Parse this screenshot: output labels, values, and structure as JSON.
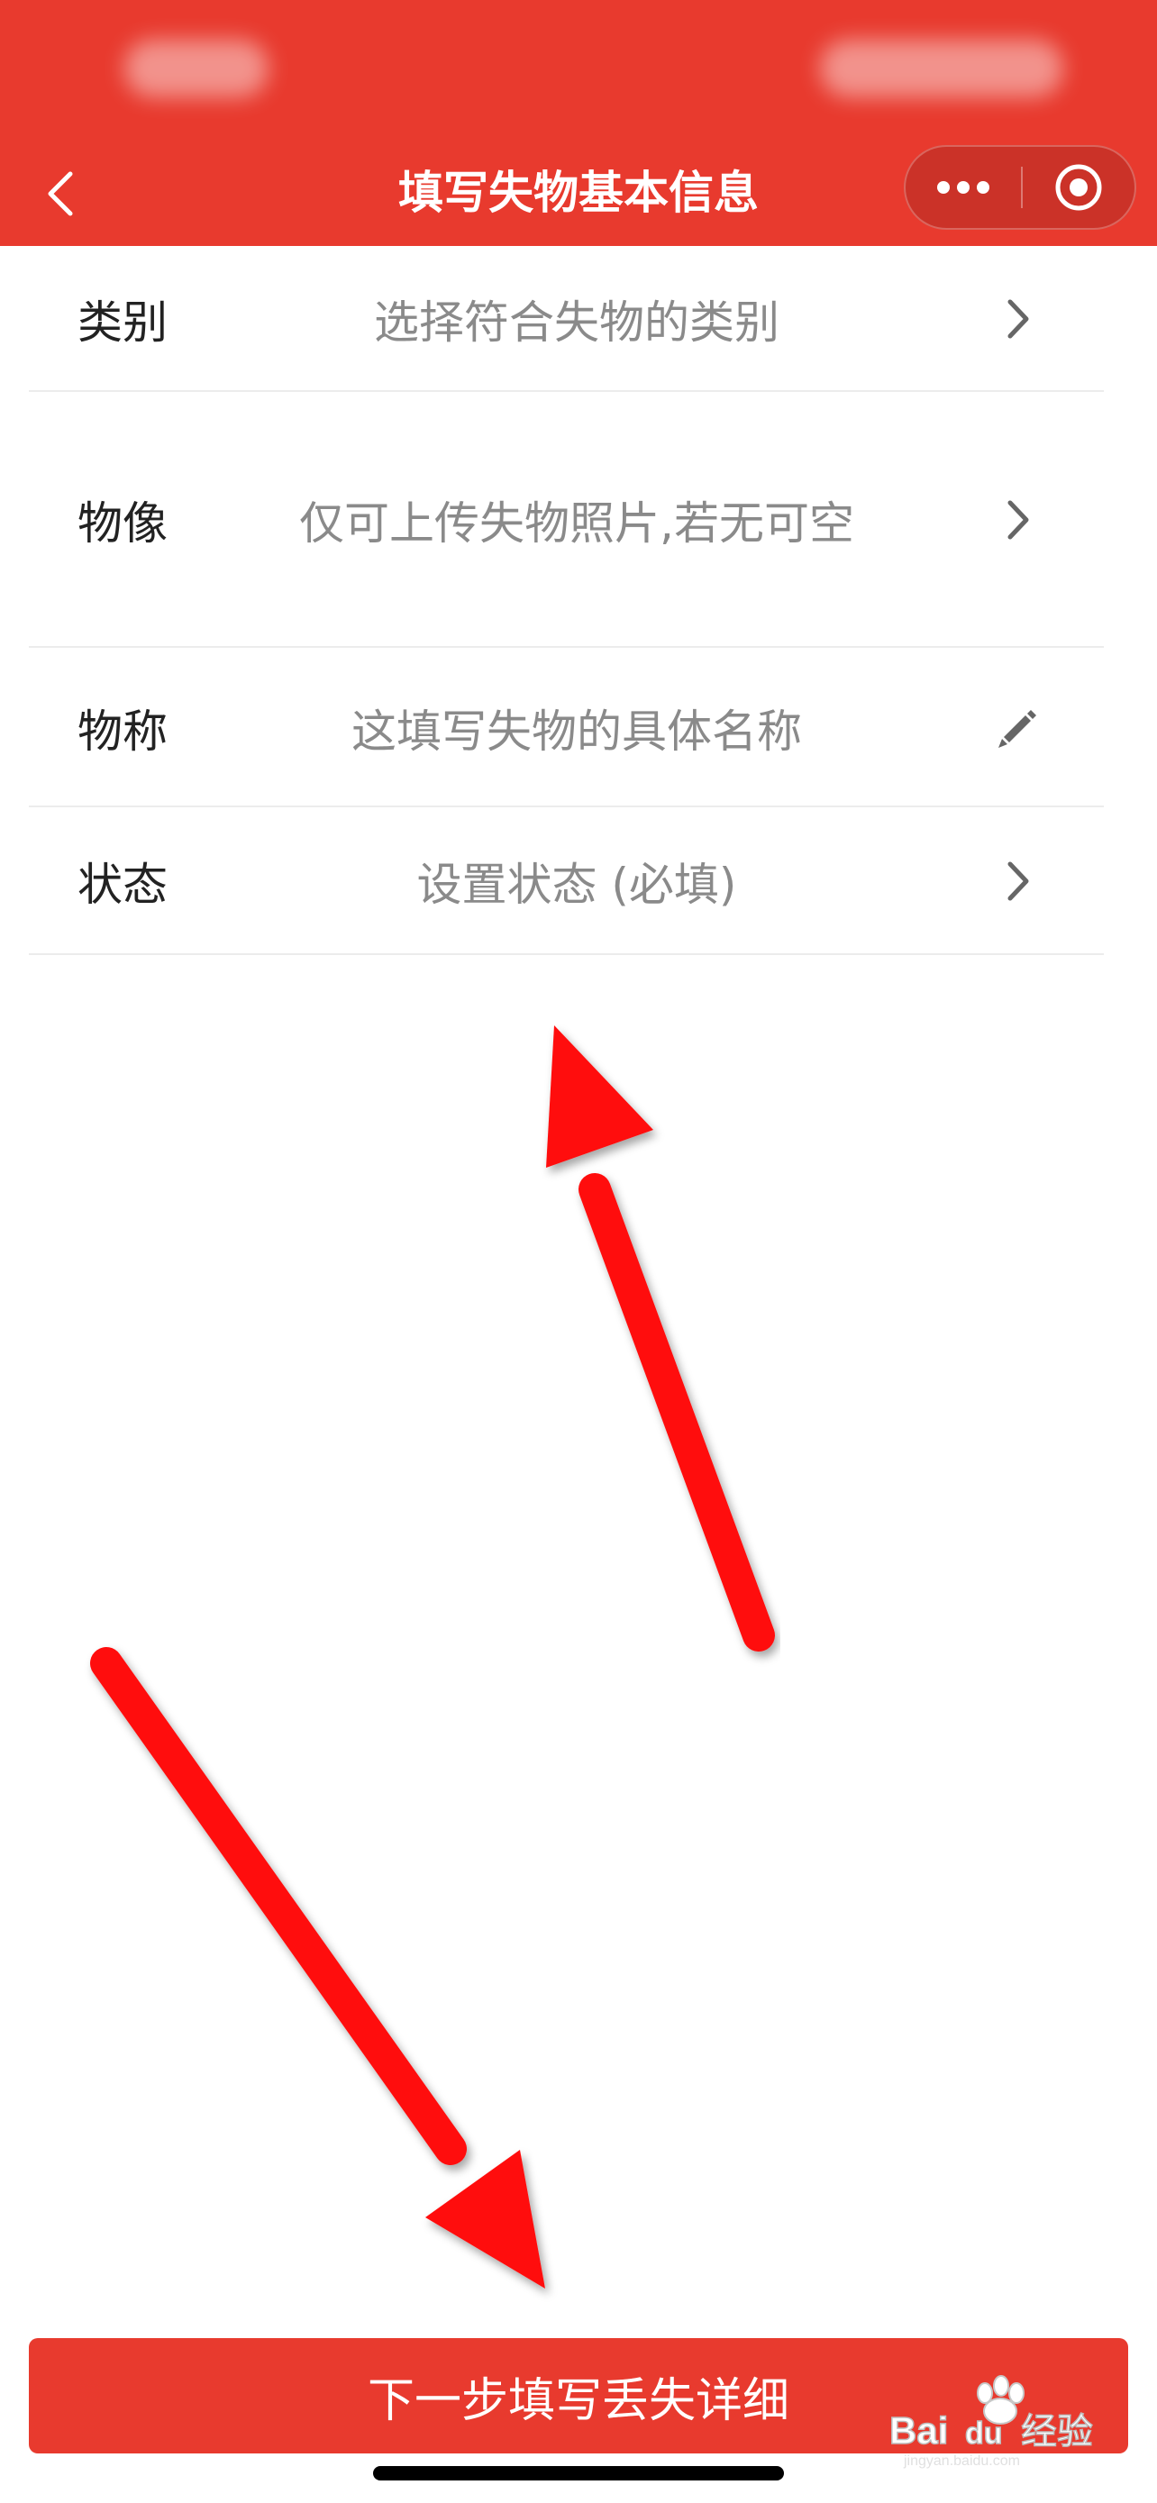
{
  "nav": {
    "title": "填写失物基本信息",
    "back_icon": "chevron-left-icon",
    "more_icon": "more-dots-icon",
    "close_icon": "target-close-icon"
  },
  "form": {
    "rows": [
      {
        "label": "类别",
        "placeholder": "选择符合失物的类别",
        "icon": "chevron-right-icon"
      },
      {
        "label": "物像",
        "placeholder": "仅可上传失物照片,若无可空",
        "icon": "chevron-right-icon"
      },
      {
        "label": "物称",
        "placeholder": "这填写失物的具体名称",
        "icon": "pencil-icon"
      },
      {
        "label": "状态",
        "placeholder": "设置状态 (必填)",
        "icon": "chevron-right-icon"
      }
    ]
  },
  "next_button": {
    "label": "下一步填写丢失详细"
  },
  "watermark": {
    "brand": "Baidu经验",
    "site": "jingyan.baidu.com"
  },
  "colors": {
    "accent": "#e83a2e",
    "arrow": "#ff1010",
    "label": "#222222",
    "placeholder": "#8a8a8a"
  }
}
